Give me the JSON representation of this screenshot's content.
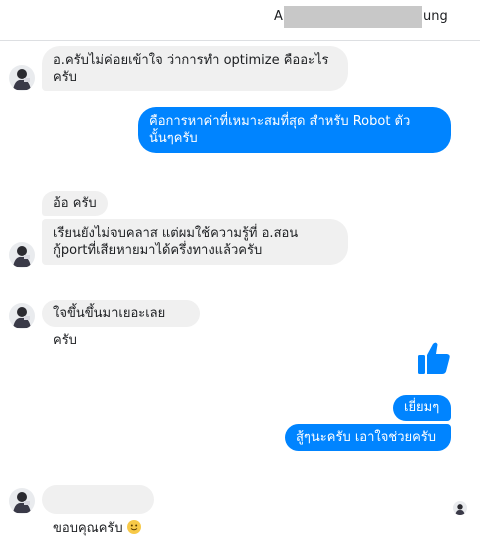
{
  "header": {
    "name_prefix": "A",
    "name_suffix": "ung"
  },
  "messages": [
    {
      "side": "in",
      "text": "อ.ครับไม่ค่อยเข้าใจ ว่าการทำ optimize คืออะไร\nครับ"
    },
    {
      "side": "out",
      "text": "คือการหาค่าที่เหมาะสมที่สุด สำหรับ Robot ตัว\nนั้นๆครับ"
    },
    {
      "side": "in",
      "text": "อ้อ ครับ"
    },
    {
      "side": "in",
      "text": "เรียนยังไม่จบคลาส แต่ผมใช้ความรู้ที่  อ.สอน\nกู้portที่เสียหายมาได้ครึ่งทางแล้วครับ"
    },
    {
      "side": "in",
      "text": "ใจขึ้นขึ้นมาเยอะเลยครับ"
    },
    {
      "side": "out",
      "type": "like"
    },
    {
      "side": "out",
      "text": "เยี่ยมๆ"
    },
    {
      "side": "out",
      "text": "สู้ๆนะครับ เอาใจช่วยครับ"
    },
    {
      "side": "in",
      "text": "ขอบคุณครับ",
      "emoji": "slightly-smiling-face-icon"
    }
  ],
  "colors": {
    "outgoing": "#0084ff",
    "incoming": "#f0f0f0"
  }
}
